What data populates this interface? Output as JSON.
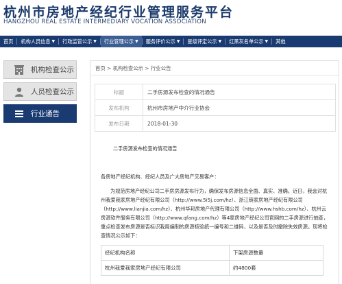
{
  "header": {
    "title": "杭州市房地产经纪行业管理服务平台",
    "subtitle": "HANGZHOU REAL ESTATE INTERMEDIARY VOCATION ASSOCIATION"
  },
  "nav": {
    "items": [
      {
        "label": "首页",
        "dropdown": false,
        "active": false
      },
      {
        "label": "机构人员信息",
        "dropdown": true,
        "active": false
      },
      {
        "label": "行政监管公示",
        "dropdown": true,
        "active": false
      },
      {
        "label": "行业管理公示",
        "dropdown": true,
        "active": true
      },
      {
        "label": "服务评价公示",
        "dropdown": true,
        "active": false
      },
      {
        "label": "星级评定公示",
        "dropdown": true,
        "active": false
      },
      {
        "label": "红黑灰名单公示",
        "dropdown": true,
        "active": false
      },
      {
        "label": "其他",
        "dropdown": false,
        "active": false
      }
    ]
  },
  "sidebar": {
    "items": [
      {
        "label": "机构检查公示",
        "icon": "building-icon"
      },
      {
        "label": "人员检查公示",
        "icon": "person-icon"
      },
      {
        "label": "行业通告",
        "icon": "list-icon"
      }
    ]
  },
  "breadcrumb": "首页 > 机构检查公示 > 行业公告",
  "meta": {
    "title_label": "标题",
    "title_value": "二手房源发布检查的情况通告",
    "org_label": "发布机构",
    "org_value": "杭州市房地产中介行业协会",
    "date_label": "发布日期",
    "date_value": "2018-01-30"
  },
  "article": {
    "heading": "二手房源发布检查的情况通告",
    "greeting": "各房地产经纪机构、经纪人员及广大房地产交易客户：",
    "body": "为规范房地产经纪公司二手房房源发布行为，确保发布房源信息全面、真实、准确。近日，我会对杭州我爱我家房地产经纪有限公司（http://www.5i5j.com/hz）、浙江链家房地产经纪有限公司（http://www.lianjia.com/hz）、杭州华邦房地产代理有限公司（http://www.hshb.com/hz）、杭州云房源软件服务有限公司（http://www.qfang.com/hz）等4家房地产经纪公司官网的二手房源进行抽查，重点检查发布房源是否标识我局编制的房源核验统一编号和二维码，以及是否及时撤除失效房源。现将检查情况公示如下："
  },
  "results_table": {
    "headers": [
      "经纪机构名称",
      "下架房源数量"
    ],
    "rows": [
      [
        "杭州我爱我家房地产经纪有限公司",
        "约4800套"
      ]
    ]
  }
}
